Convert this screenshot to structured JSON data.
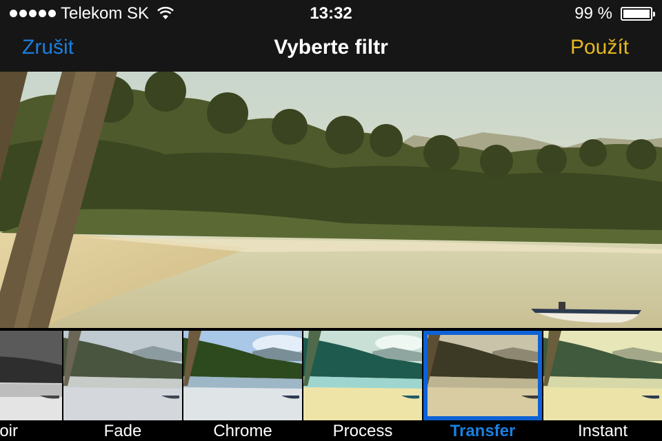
{
  "status": {
    "carrier": "Telekom SK",
    "time": "13:32",
    "battery": "99 %",
    "battery_level": 0.99
  },
  "nav": {
    "cancel": "Zrušit",
    "title": "Vyberte filtr",
    "apply": "Použít"
  },
  "filters": [
    {
      "label": "Noir",
      "selected": false
    },
    {
      "label": "Fade",
      "selected": false
    },
    {
      "label": "Chrome",
      "selected": false
    },
    {
      "label": "Process",
      "selected": false
    },
    {
      "label": "Transfer",
      "selected": true
    },
    {
      "label": "Instant",
      "selected": false
    }
  ],
  "colors": {
    "accent_blue": "#1a7fe0",
    "accent_yellow": "#e6b820",
    "selection": "#0e62d6"
  }
}
